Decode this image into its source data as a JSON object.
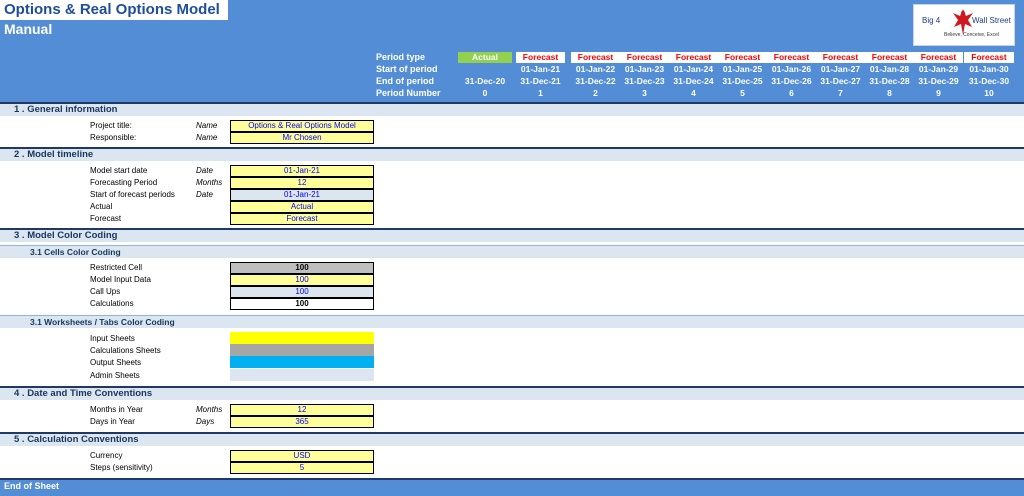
{
  "header": {
    "title": "Options & Real Options Model",
    "subtitle": "Manual",
    "logo_text_left": "Big 4",
    "logo_text_right": "Wall Street",
    "logo_tagline": "Believe, Conceive, Excel",
    "logo_icon": "eagle-icon"
  },
  "timeline_labels": {
    "period_type": "Period type",
    "start_of_period": "Start of period",
    "end_of_period": "End of period",
    "period_number": "Period Number"
  },
  "periods": [
    {
      "type": "Actual",
      "start": "",
      "end": "31-Dec-20",
      "number": "0"
    },
    {
      "type": "Forecast",
      "start": "01-Jan-21",
      "end": "31-Dec-21",
      "number": "1"
    },
    {
      "type": "Forecast",
      "start": "01-Jan-22",
      "end": "31-Dec-22",
      "number": "2"
    },
    {
      "type": "Forecast",
      "start": "01-Jan-23",
      "end": "31-Dec-23",
      "number": "3"
    },
    {
      "type": "Forecast",
      "start": "01-Jan-24",
      "end": "31-Dec-24",
      "number": "4"
    },
    {
      "type": "Forecast",
      "start": "01-Jan-25",
      "end": "31-Dec-25",
      "number": "5"
    },
    {
      "type": "Forecast",
      "start": "01-Jan-26",
      "end": "31-Dec-26",
      "number": "6"
    },
    {
      "type": "Forecast",
      "start": "01-Jan-27",
      "end": "31-Dec-27",
      "number": "7"
    },
    {
      "type": "Forecast",
      "start": "01-Jan-28",
      "end": "31-Dec-28",
      "number": "8"
    },
    {
      "type": "Forecast",
      "start": "01-Jan-29",
      "end": "31-Dec-29",
      "number": "9"
    },
    {
      "type": "Forecast",
      "start": "01-Jan-30",
      "end": "31-Dec-30",
      "number": "10"
    }
  ],
  "colors": {
    "header_blue": "#538dd5",
    "actual_green": "#92d050",
    "forecast_red": "#ff0000",
    "input_yellow": "#ffff99",
    "restricted_grey": "#bfbfbf",
    "callup_blue": "#dce6f1",
    "sheet_input": "#ffff00",
    "sheet_calc": "#a6a6a6",
    "sheet_output": "#00b0f0",
    "sheet_admin": "#dce6f1"
  },
  "sections": {
    "general": {
      "title": "1 . General information",
      "project_label": "Project title:",
      "project_unit": "Name",
      "project_value": "Options & Real Options Model",
      "responsible_label": "Responsible:",
      "responsible_unit": "Name",
      "responsible_value": "Mr Chosen"
    },
    "timeline": {
      "title": "2 . Model timeline",
      "start_label": "Model start date",
      "start_unit": "Date",
      "start_value": "01-Jan-21",
      "fp_label": "Forecasting Period",
      "fp_unit": "Months",
      "fp_value": "12",
      "sfp_label": "Start of forecast periods",
      "sfp_unit": "Date",
      "sfp_value": "01-Jan-21",
      "actual_label": "Actual",
      "actual_value": "Actual",
      "forecast_label": "Forecast",
      "forecast_value": "Forecast"
    },
    "color": {
      "title": "3 . Model Color Coding",
      "cells_title": "3.1 Cells Color Coding",
      "restricted_label": "Restricted Cell",
      "restricted_value": "100",
      "input_label": "Model Input Data",
      "input_value": "100",
      "callups_label": "Call Ups",
      "callups_value": "100",
      "calcs_label": "Calculations",
      "calcs_value": "100",
      "sheets_title": "3.1 Worksheets / Tabs Color Coding",
      "input_sheets": "Input Sheets",
      "calc_sheets": "Calculations Sheets",
      "output_sheets": "Output Sheets",
      "admin_sheets": "Admin Sheets"
    },
    "datetime": {
      "title": "4 . Date and Time Conventions",
      "months_label": "Months in Year",
      "months_unit": "Months",
      "months_value": "12",
      "days_label": "Days in Year",
      "days_unit": "Days",
      "days_value": "365"
    },
    "calc": {
      "title": "5 . Calculation Conventions",
      "currency_label": "Currency",
      "currency_value": "USD",
      "steps_label": "Steps (sensitivity)",
      "steps_value": "5"
    }
  },
  "footer": "End of Sheet"
}
